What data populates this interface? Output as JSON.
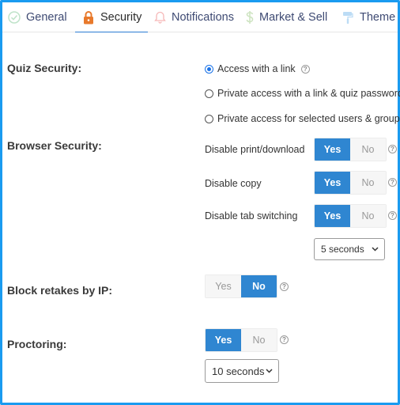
{
  "tabs": [
    {
      "label": "General",
      "icon": "check-circle-icon"
    },
    {
      "label": "Security",
      "icon": "lock-icon",
      "active": true
    },
    {
      "label": "Notifications",
      "icon": "bell-icon"
    },
    {
      "label": "Market & Sell",
      "icon": "dollar-icon"
    },
    {
      "label": "Theme",
      "icon": "paint-roller-icon"
    }
  ],
  "quiz_security": {
    "label": "Quiz Security:",
    "options": [
      "Access with a link",
      "Private access with a link & quiz password",
      "Private access for selected users & groups"
    ],
    "selected_index": 0
  },
  "browser_security": {
    "label": "Browser Security:",
    "disable_print": {
      "label": "Disable print/download",
      "value": "Yes"
    },
    "disable_copy": {
      "label": "Disable copy",
      "value": "Yes"
    },
    "disable_tab": {
      "label": "Disable tab switching",
      "value": "Yes"
    },
    "tab_delay_value": "5 seconds"
  },
  "block_retakes": {
    "label": "Block retakes by IP:",
    "value": "No"
  },
  "proctoring": {
    "label": "Proctoring:",
    "value": "Yes",
    "delay_value": "10 seconds"
  },
  "toggle_labels": {
    "yes": "Yes",
    "no": "No"
  },
  "help_glyph": "?",
  "colors": {
    "accent": "#2f86d1",
    "frame": "#1a9bf0",
    "tab_text": "#3e4a73"
  }
}
